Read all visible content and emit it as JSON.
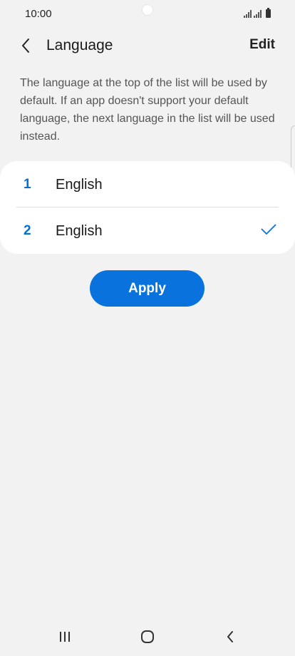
{
  "status_bar": {
    "time": "10:00"
  },
  "header": {
    "title": "Language",
    "edit_label": "Edit"
  },
  "description": "The language at the top of the list will be used by default. If an app doesn't support your default language, the next language in the list will be used instead.",
  "languages": [
    {
      "number": "1",
      "name": "English",
      "checked": false
    },
    {
      "number": "2",
      "name": "English",
      "checked": true
    }
  ],
  "apply_label": "Apply",
  "colors": {
    "accent": "#0a72dc",
    "number": "#0a6fc8",
    "background": "#f2f2f2"
  },
  "icons": {
    "back": "chevron-left-icon",
    "check": "check-icon",
    "nav_recent": "recent-apps-icon",
    "nav_home": "home-icon",
    "nav_back": "back-icon"
  }
}
